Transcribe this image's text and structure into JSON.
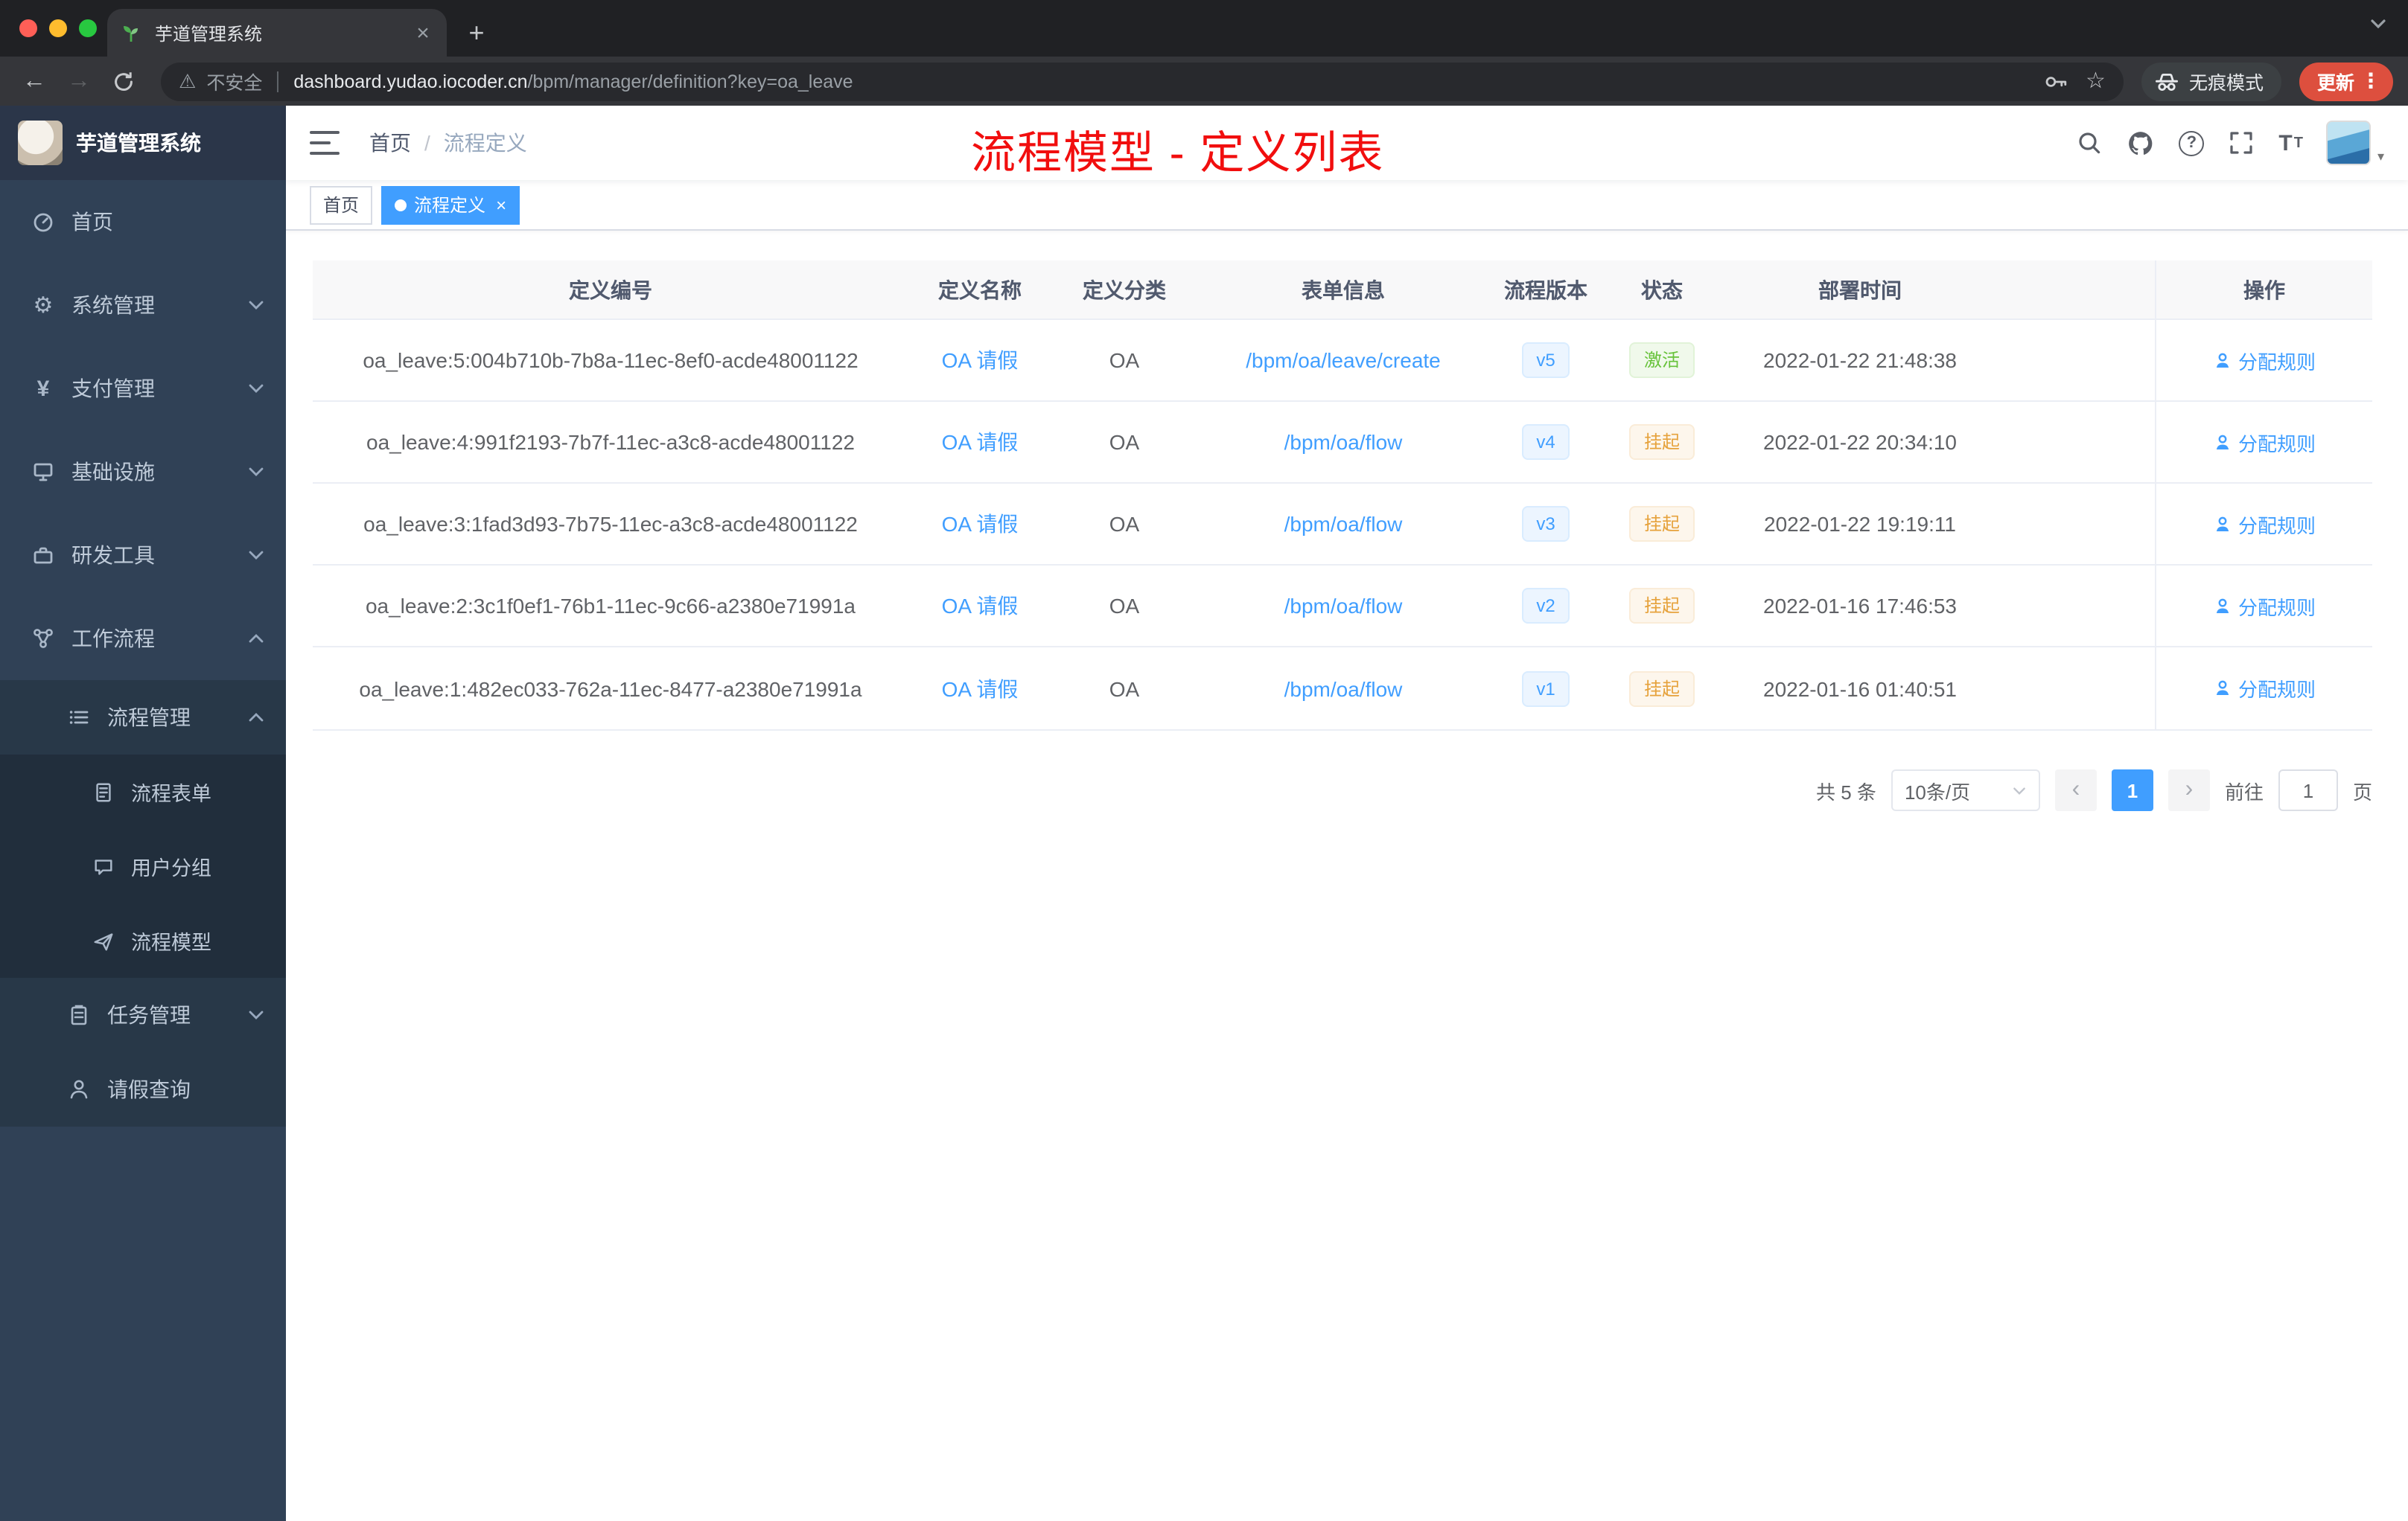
{
  "browser": {
    "tab": {
      "title": "芋道管理系统"
    },
    "toolbar": {
      "security_label": "不安全",
      "url_host": "dashboard.yudao.iocoder.cn",
      "url_path": "/bpm/manager/definition?key=oa_leave",
      "profile_label": "无痕模式",
      "update_label": "更新"
    }
  },
  "sidebar": {
    "app_name": "芋道管理系统",
    "items": [
      {
        "label": "首页",
        "icon": "dashboard-icon",
        "level": 1
      },
      {
        "label": "系统管理",
        "icon": "gear-icon",
        "level": 1,
        "expanded": false
      },
      {
        "label": "支付管理",
        "icon": "payment-icon",
        "level": 1,
        "expanded": false
      },
      {
        "label": "基础设施",
        "icon": "infrastructure-icon",
        "level": 1,
        "expanded": false
      },
      {
        "label": "研发工具",
        "icon": "devtools-icon",
        "level": 1,
        "expanded": false
      },
      {
        "label": "工作流程",
        "icon": "workflow-icon",
        "level": 1,
        "expanded": true
      },
      {
        "label": "流程管理",
        "icon": "process-manage-icon",
        "level": 2,
        "expanded": true
      },
      {
        "label": "流程表单",
        "icon": "form-icon",
        "level": 3
      },
      {
        "label": "用户分组",
        "icon": "user-group-icon",
        "level": 3
      },
      {
        "label": "流程模型",
        "icon": "model-icon",
        "level": 3
      },
      {
        "label": "任务管理",
        "icon": "task-icon",
        "level": 2,
        "expanded": false
      },
      {
        "label": "请假查询",
        "icon": "leave-query-icon",
        "level": 2
      }
    ]
  },
  "header": {
    "breadcrumb": {
      "home": "首页",
      "current": "流程定义"
    },
    "annotation": "流程模型 - 定义列表"
  },
  "tags": [
    {
      "label": "首页",
      "active": false
    },
    {
      "label": "流程定义",
      "active": true
    }
  ],
  "table": {
    "columns": [
      "定义编号",
      "定义名称",
      "定义分类",
      "表单信息",
      "流程版本",
      "状态",
      "部署时间",
      "操作"
    ],
    "rows": [
      {
        "id": "oa_leave:5:004b710b-7b8a-11ec-8ef0-acde48001122",
        "name": "OA 请假",
        "category": "OA",
        "form": "/bpm/oa/leave/create",
        "version": "v5",
        "status": "激活",
        "status_type": "success",
        "time": "2022-01-22 21:48:38",
        "action": "分配规则"
      },
      {
        "id": "oa_leave:4:991f2193-7b7f-11ec-a3c8-acde48001122",
        "name": "OA 请假",
        "category": "OA",
        "form": "/bpm/oa/flow",
        "version": "v4",
        "status": "挂起",
        "status_type": "warning",
        "time": "2022-01-22 20:34:10",
        "action": "分配规则"
      },
      {
        "id": "oa_leave:3:1fad3d93-7b75-11ec-a3c8-acde48001122",
        "name": "OA 请假",
        "category": "OA",
        "form": "/bpm/oa/flow",
        "version": "v3",
        "status": "挂起",
        "status_type": "warning",
        "time": "2022-01-22 19:19:11",
        "action": "分配规则"
      },
      {
        "id": "oa_leave:2:3c1f0ef1-76b1-11ec-9c66-a2380e71991a",
        "name": "OA 请假",
        "category": "OA",
        "form": "/bpm/oa/flow",
        "version": "v2",
        "status": "挂起",
        "status_type": "warning",
        "time": "2022-01-16 17:46:53",
        "action": "分配规则"
      },
      {
        "id": "oa_leave:1:482ec033-762a-11ec-8477-a2380e71991a",
        "name": "OA 请假",
        "category": "OA",
        "form": "/bpm/oa/flow",
        "version": "v1",
        "status": "挂起",
        "status_type": "warning",
        "time": "2022-01-16 01:40:51",
        "action": "分配规则"
      }
    ]
  },
  "pagination": {
    "total": "共 5 条",
    "page_size": "10条/页",
    "current_page": "1",
    "goto_prefix": "前往",
    "goto_value": "1",
    "goto_suffix": "页"
  },
  "colors": {
    "accent": "#409eff",
    "success": "#67c23a",
    "warning": "#e6a23c",
    "annotation_red": "#f10e0e",
    "sidebar_bg": "#304156"
  },
  "icons": {
    "tab_favicon": "green-sprout",
    "security": "warning-triangle",
    "omnibox_right": [
      "key",
      "star"
    ],
    "header_right": [
      "search",
      "github",
      "question",
      "fullscreen",
      "font-size",
      "avatar"
    ]
  }
}
